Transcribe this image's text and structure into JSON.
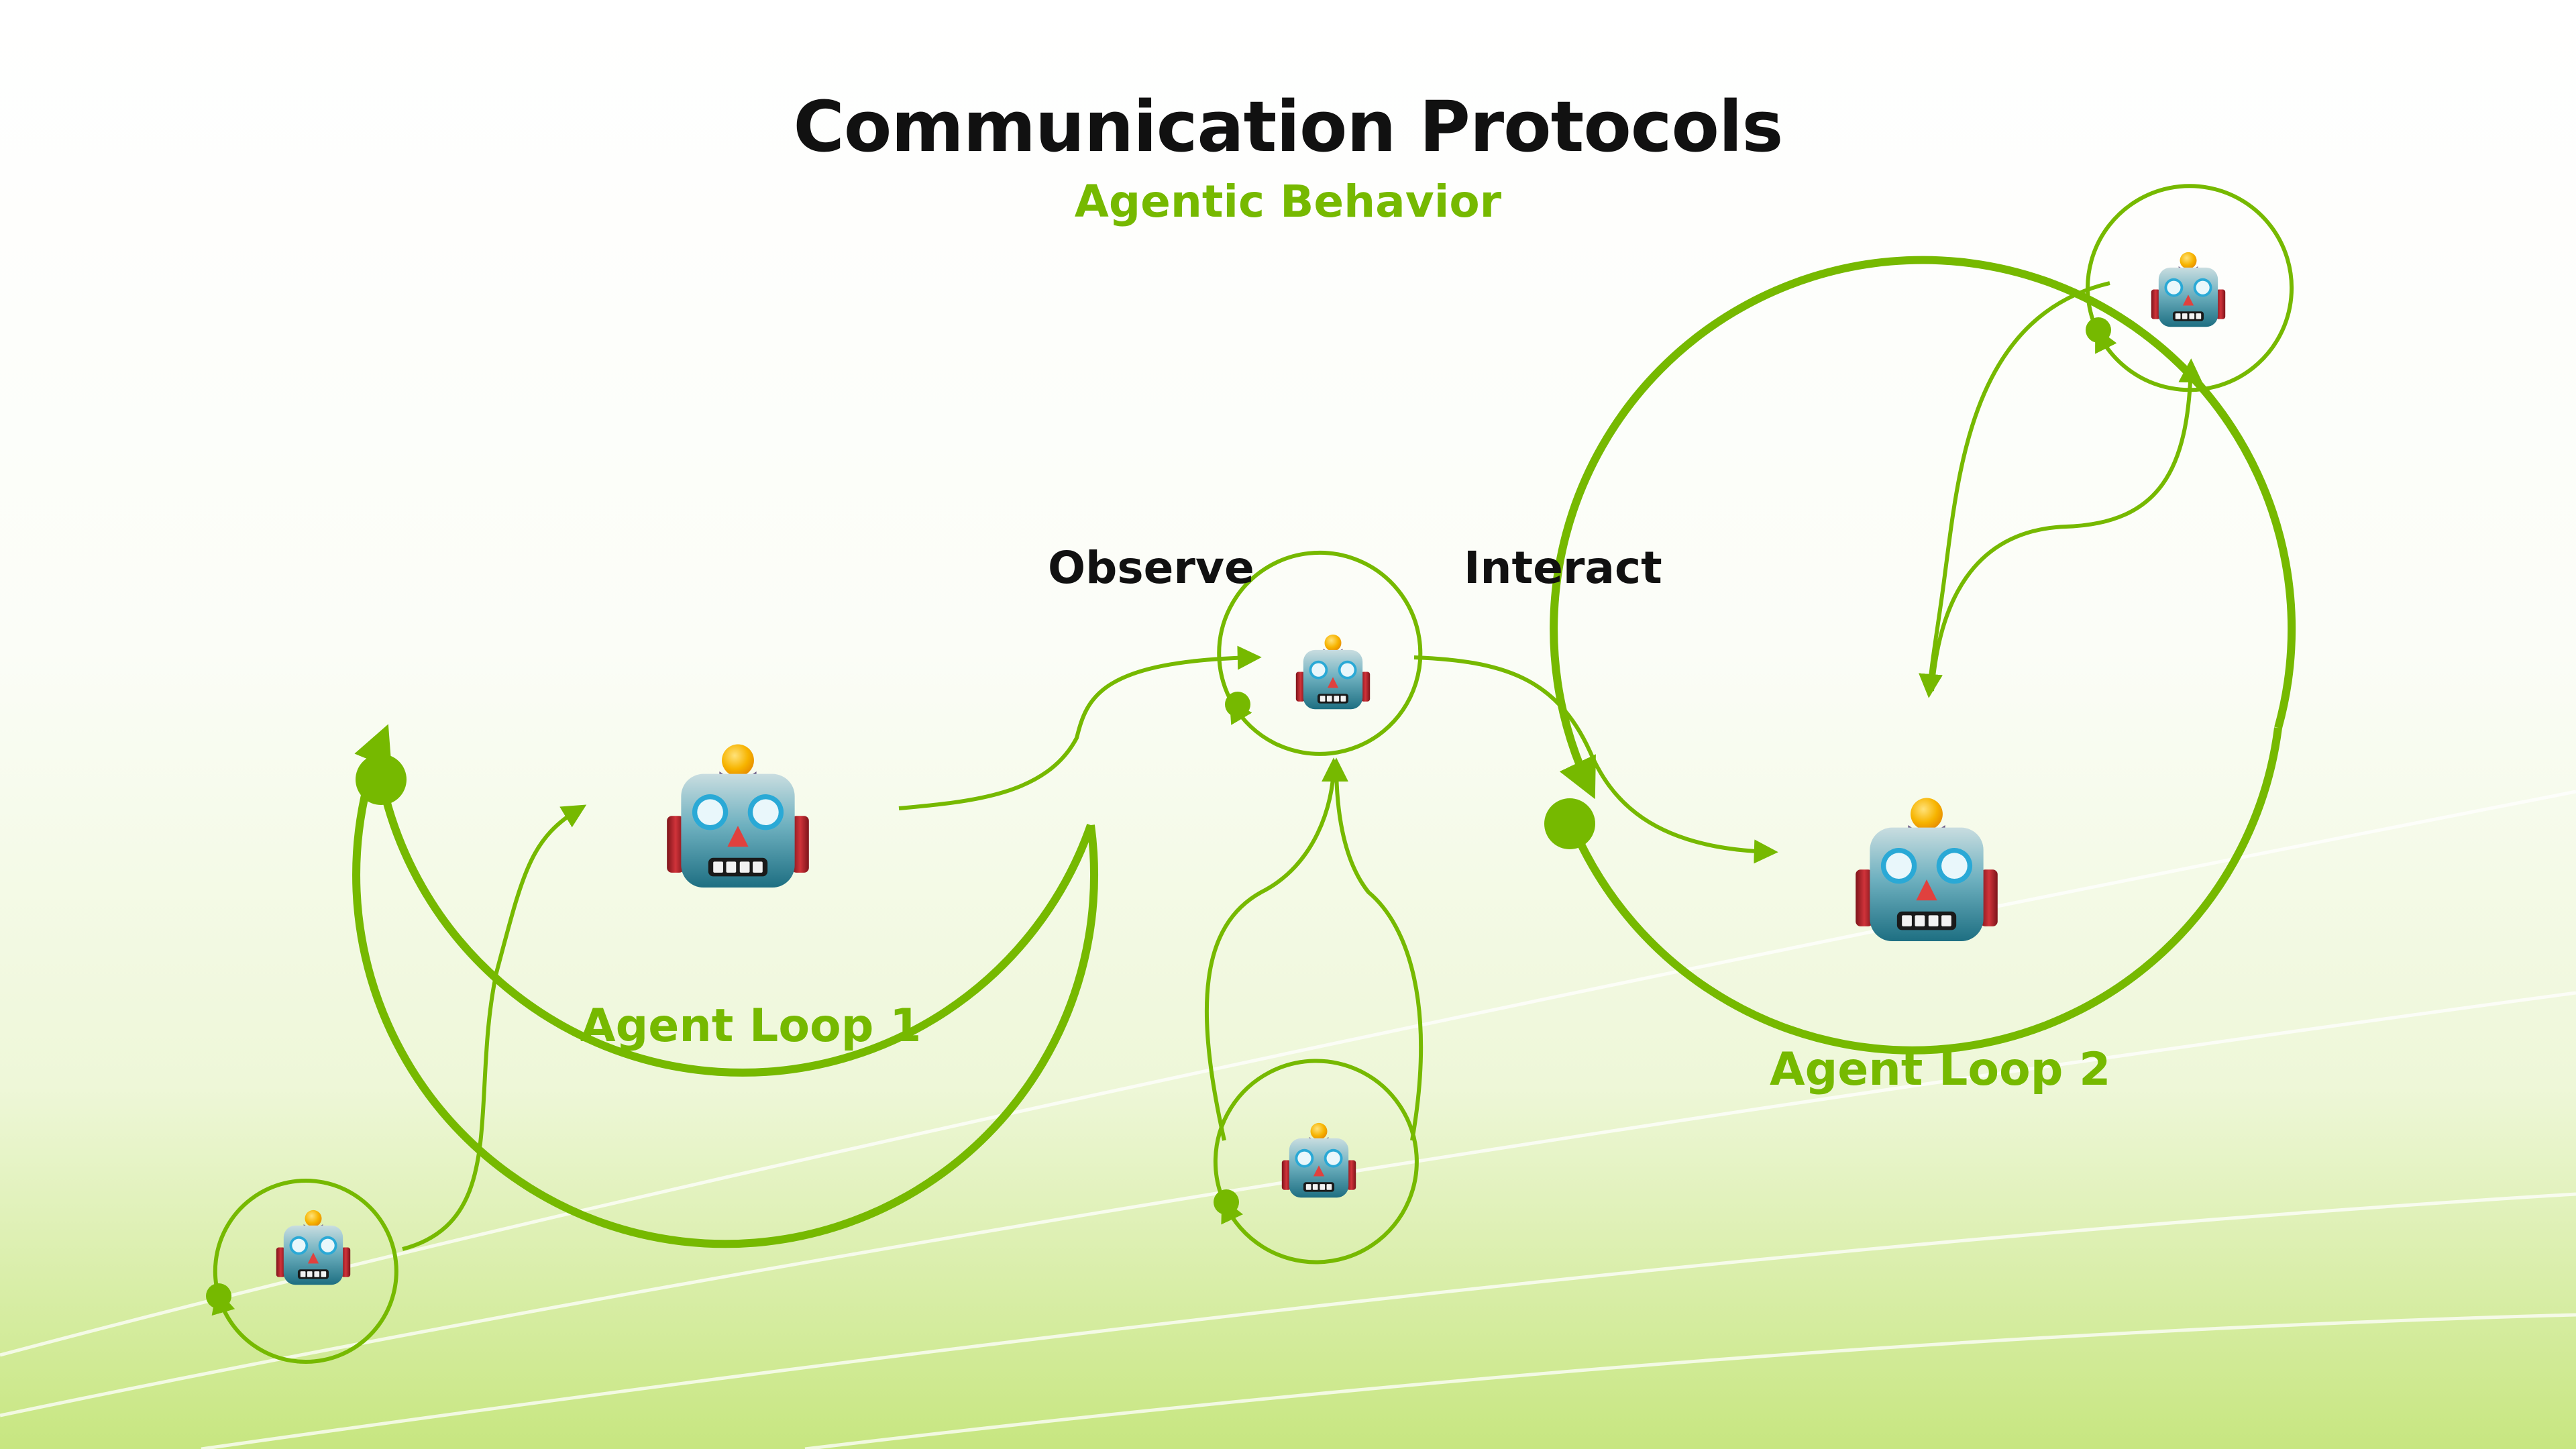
{
  "header": {
    "title": "Communication Protocols",
    "subtitle": "Agentic Behavior"
  },
  "labels": {
    "observe": "Observe",
    "interact": "Interact",
    "agent_loop_1": "Agent Loop 1",
    "agent_loop_2": "Agent Loop 2"
  },
  "colors": {
    "accent": "#76b900",
    "title": "#111111",
    "robot_face": "#5ba3b3",
    "robot_eye": "#35c8e8",
    "robot_nose": "#e0413e",
    "robot_antenna": "#f5a800",
    "robot_ear": "#b8232a",
    "robot_cap": "#6c5b87"
  },
  "icons": {
    "robot": "robot-face-icon"
  }
}
